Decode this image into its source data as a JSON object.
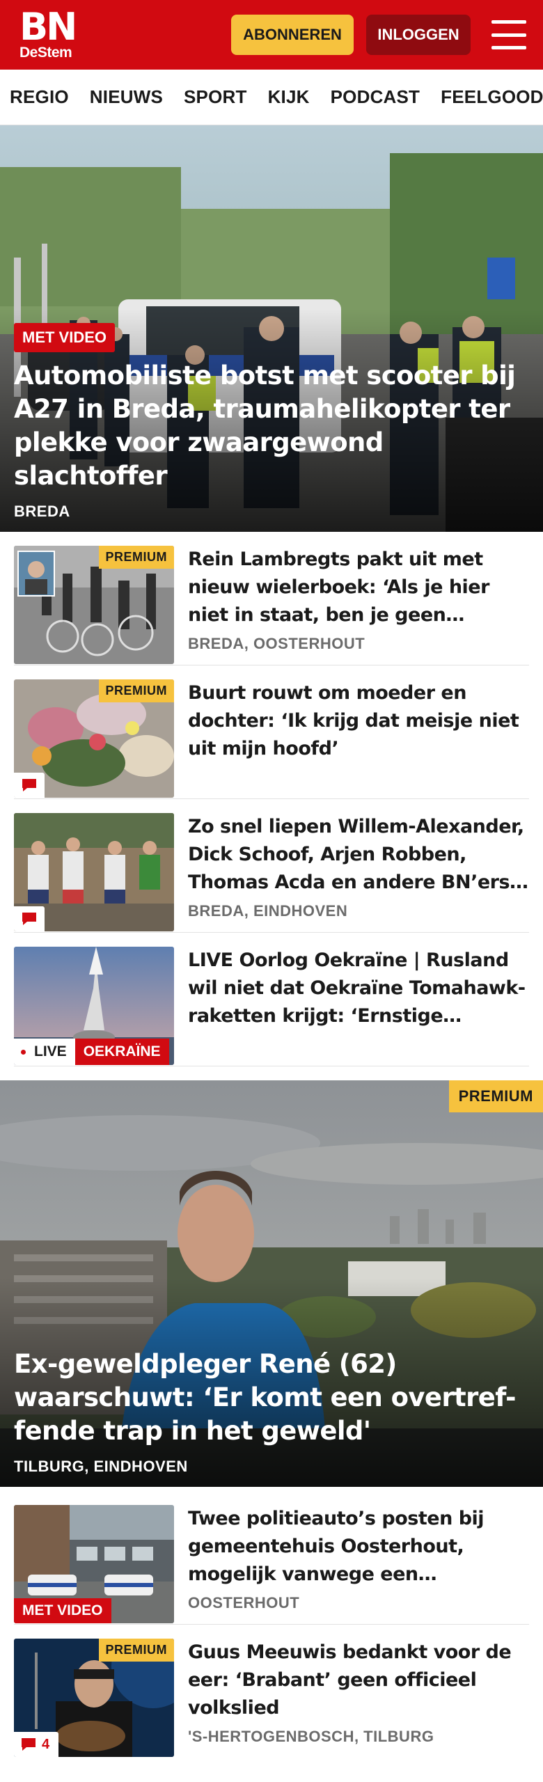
{
  "header": {
    "logo_main": "BN",
    "logo_sub": "DeStem",
    "subscribe_label": "ABONNEREN",
    "login_label": "INLOGGEN"
  },
  "nav": {
    "items": [
      "REGIO",
      "NIEUWS",
      "SPORT",
      "KIJK",
      "PODCAST",
      "FEELGOOD"
    ]
  },
  "hero": {
    "badge": "MET VIDEO",
    "title": "Automobiliste botst met scooter bij A27 in Breda, traumahelikopter ter plekke voor zwaargewond slachtoffer",
    "location": "BREDA"
  },
  "list1": [
    {
      "premium": "PREMIUM",
      "title": "Rein Lambregts pakt uit met nieuw wielerboek: ‘Als je hier niet in staat, ben je geen wielrenner…",
      "location": "BREDA, OOSTERHOUT"
    },
    {
      "premium": "PREMIUM",
      "title": "Buurt rouwt om moeder en dochter: ‘Ik krijg dat meisje niet uit mijn hoofd’",
      "location": ""
    },
    {
      "title": "Zo snel liepen Willem-Alexander, Dick Schoof, Arjen Robben, Thomas Acda en andere BN’ers…",
      "location": "BREDA, EINDHOVEN"
    },
    {
      "live_label": "LIVE",
      "topic": "OEKRAÏNE",
      "title": "LIVE Oorlog Oekraïne | Rusland wil niet dat Oekraïne Tomahawk-raketten krijgt: ‘Ernstige…",
      "location": ""
    }
  ],
  "feature": {
    "premium": "PREMIUM",
    "title": "Ex-geweldpleger René (62) waarschuwt: ‘Er komt een overtref-fende trap in het geweld'",
    "location": "TILBURG, EINDHOVEN"
  },
  "list2": [
    {
      "badge": "MET VIDEO",
      "title": "Twee politieauto’s posten bij gemeentehuis Oosterhout, mogelijk vanwege een bedreiging",
      "location": "OOSTERHOUT"
    },
    {
      "premium": "PREMIUM",
      "comment_count": "4",
      "title": "Guus Meeuwis bedankt voor de eer: ‘Brabant’ geen officieel volkslied",
      "location": "'S-HERTOGENBOSCH, TILBURG"
    }
  ],
  "colors": {
    "brand_red": "#d10a11",
    "premium_yellow": "#f6c23e",
    "login_dark_red": "#8f0b10"
  },
  "icons": {
    "menu": "hamburger-menu-icon",
    "comment": "speech-bubble-icon"
  }
}
